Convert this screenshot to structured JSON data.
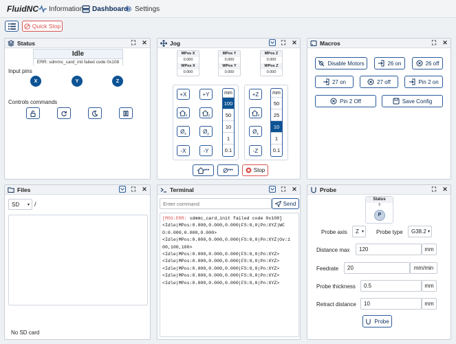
{
  "brand": {
    "name": "FluidNC"
  },
  "nav": {
    "information": "Information",
    "dashboard": "Dashboard",
    "settings": "Settings"
  },
  "toolbar": {
    "quick_stop": "Quick Stop"
  },
  "status": {
    "title": "Status",
    "state": "Idle",
    "error": "ERR: sdmmc_card_init failed code 0x108",
    "input_pins_label": "Input pins",
    "pins": [
      "X",
      "Y",
      "Z"
    ],
    "controls_label": "Controls commands"
  },
  "jog": {
    "title": "Jog",
    "mpos_x_label": "MPos X",
    "mpos_x": "0.000",
    "wpos_x_label": "WPos X",
    "wpos_x": "0.000",
    "mpos_y_label": "MPos Y",
    "mpos_y": "0.000",
    "wpos_y_label": "WPos Y",
    "wpos_y": "0.000",
    "mpos_z_label": "MPos Z",
    "mpos_z": "0.000",
    "wpos_z_label": "WPos Z",
    "wpos_z": "0.000",
    "plus_x": "+X",
    "plus_y": "+Y",
    "minus_x": "-X",
    "minus_y": "-Y",
    "plus_z": "+Z",
    "minus_z": "-Z",
    "home_x": "x",
    "home_y": "y",
    "home_z": "z",
    "zero_x": "x",
    "zero_y": "y",
    "zero_z": "z",
    "xy_steps_header": "mm",
    "xy_steps": [
      "100",
      "50",
      "10",
      "1",
      "0.1"
    ],
    "xy_selected": "100",
    "z_steps_header": "mm",
    "z_steps": [
      "50",
      "25",
      "10",
      "1",
      "0.1"
    ],
    "z_selected": "10",
    "stop_label": "Stop"
  },
  "macros": {
    "title": "Macros",
    "buttons": [
      "Disable Motors",
      "26 on",
      "26 off",
      "27 on",
      "27 off",
      "Pin 2 on",
      "Pin 2 Off",
      "Save Config"
    ]
  },
  "files": {
    "title": "Files",
    "source": "SD",
    "path": "/",
    "footer": "No SD card"
  },
  "terminal": {
    "title": "Terminal",
    "placeholder": "Enter command",
    "send_label": "Send",
    "msg_prefix": "[MSG:ERR:",
    "msg_rest": " sdmmc_card_init failed code 0x108]",
    "lines": [
      "<Idle|MPos:0.000,0.000,0.000|FS:0,0|Pn:XYZ|WC",
      "O:0.000,0.000,0.000>",
      "<Idle|MPos:0.000,0.000,0.000|FS:0,0|Pn:XYZ|Ov:1",
      "00,100,100>",
      "<Idle|MPos:0.000,0.000,0.000|FS:0,0|Pn:XYZ>",
      "<Idle|MPos:0.000,0.000,0.000|FS:0,0|Pn:XYZ>",
      "<Idle|MPos:0.000,0.000,0.000|FS:0,0|Pn:XYZ>",
      "<Idle|MPos:0.000,0.000,0.000|FS:0,0|Pn:XYZ>",
      "<Idle|MPos:0.000,0.000,0.000|FS:0,0|Pn:XYZ>"
    ]
  },
  "probe": {
    "title": "Probe",
    "status_label": "Status",
    "status_value": "?",
    "status_badge": "P",
    "axis_label": "Probe axis",
    "axis_value": "Z",
    "type_label": "Probe type",
    "type_value": "G38.2",
    "distance_label": "Distance max",
    "distance_value": "120",
    "distance_unit": "mm",
    "feed_label": "Feedrate",
    "feed_value": "20",
    "feed_unit": "mm/min",
    "thickness_label": "Probe thickness",
    "thickness_value": "0.5",
    "thickness_unit": "mm",
    "retract_label": "Retract distance",
    "retract_value": "10",
    "retract_unit": "mm",
    "button_label": "Probe"
  },
  "colors": {
    "accent": "#0d5394",
    "danger": "#d9534f"
  }
}
